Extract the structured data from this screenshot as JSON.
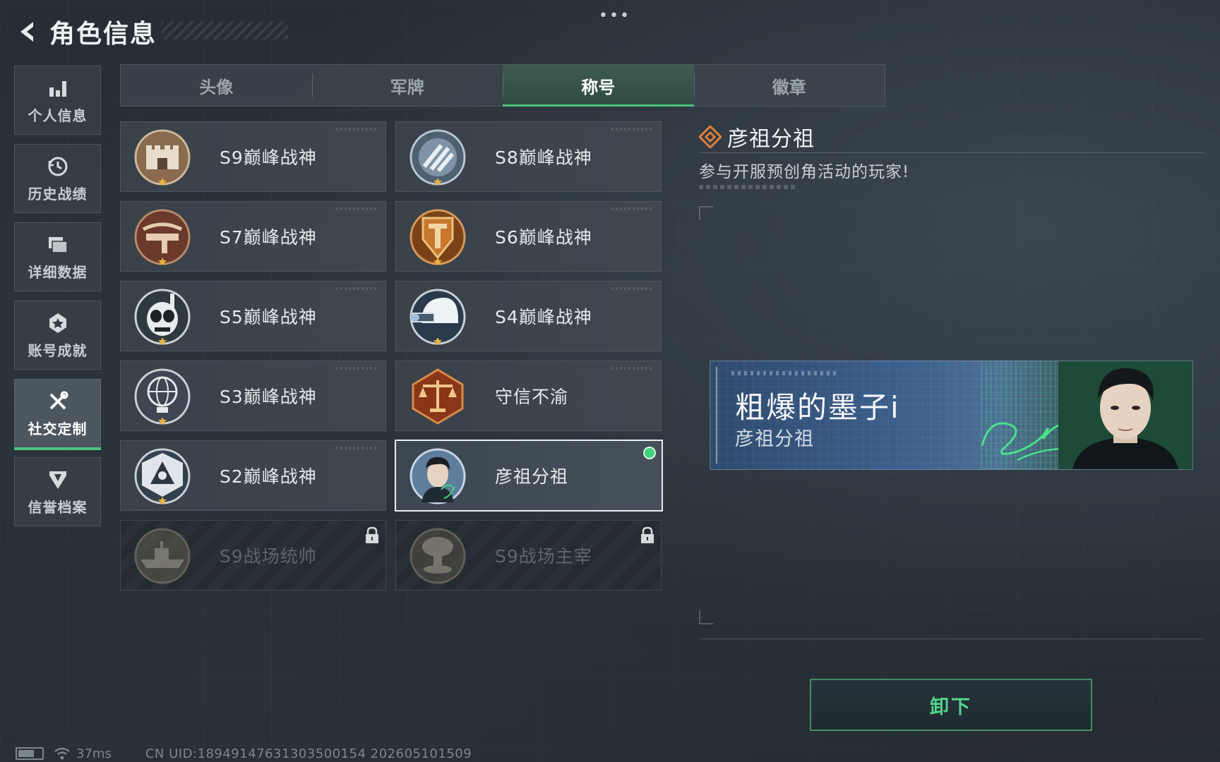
{
  "header": {
    "title": "角色信息",
    "menu_dots": "•••"
  },
  "sidebar": {
    "items": [
      {
        "label": "个人信息",
        "icon": "bar-chart-icon"
      },
      {
        "label": "历史战绩",
        "icon": "clock-icon"
      },
      {
        "label": "详细数据",
        "icon": "folder-icon"
      },
      {
        "label": "账号成就",
        "icon": "medal-icon"
      },
      {
        "label": "社交定制",
        "icon": "tools-icon",
        "active": true
      },
      {
        "label": "信誉档案",
        "icon": "shield-icon"
      }
    ]
  },
  "tabs": [
    {
      "label": "头像"
    },
    {
      "label": "军牌"
    },
    {
      "label": "称号",
      "active": true
    },
    {
      "label": "徽章"
    }
  ],
  "titles": [
    {
      "name": "S9巅峰战神",
      "icon": "fortress-badge-icon"
    },
    {
      "name": "S8巅峰战神",
      "icon": "stripes-badge-icon"
    },
    {
      "name": "S7巅峰战神",
      "icon": "crossbow-badge-icon"
    },
    {
      "name": "S6巅峰战神",
      "icon": "t-shield-badge-icon"
    },
    {
      "name": "S5巅峰战神",
      "icon": "diver-skull-badge-icon"
    },
    {
      "name": "S4巅峰战神",
      "icon": "night-vision-helmet-badge-icon"
    },
    {
      "name": "S3巅峰战神",
      "icon": "globe-badge-icon"
    },
    {
      "name": "守信不渝",
      "icon": "scales-badge-icon"
    },
    {
      "name": "S2巅峰战神",
      "icon": "triangle-badge-icon"
    },
    {
      "name": "彦祖分祖",
      "icon": "portrait-badge-icon",
      "selected": true
    },
    {
      "name": "S9战场统帅",
      "icon": "warship-badge-icon",
      "locked": true
    },
    {
      "name": "S9战场主宰",
      "icon": "mushroom-cloud-badge-icon",
      "locked": true
    }
  ],
  "detail": {
    "title": "彦祖分祖",
    "description": "参与开服预创角活动的玩家!"
  },
  "nameplate": {
    "player_name": "粗爆的墨子i",
    "title": "彦祖分祖"
  },
  "actions": {
    "unequip_label": "卸下"
  },
  "footer": {
    "ping": "37ms",
    "uid": "CN UID:18949147631303500154 202605101509"
  },
  "colors": {
    "accent_green": "#4ac27f",
    "selected_dot": "#3fd27a",
    "detail_icon_orange": "#e0803a",
    "background": "#2a3239"
  }
}
